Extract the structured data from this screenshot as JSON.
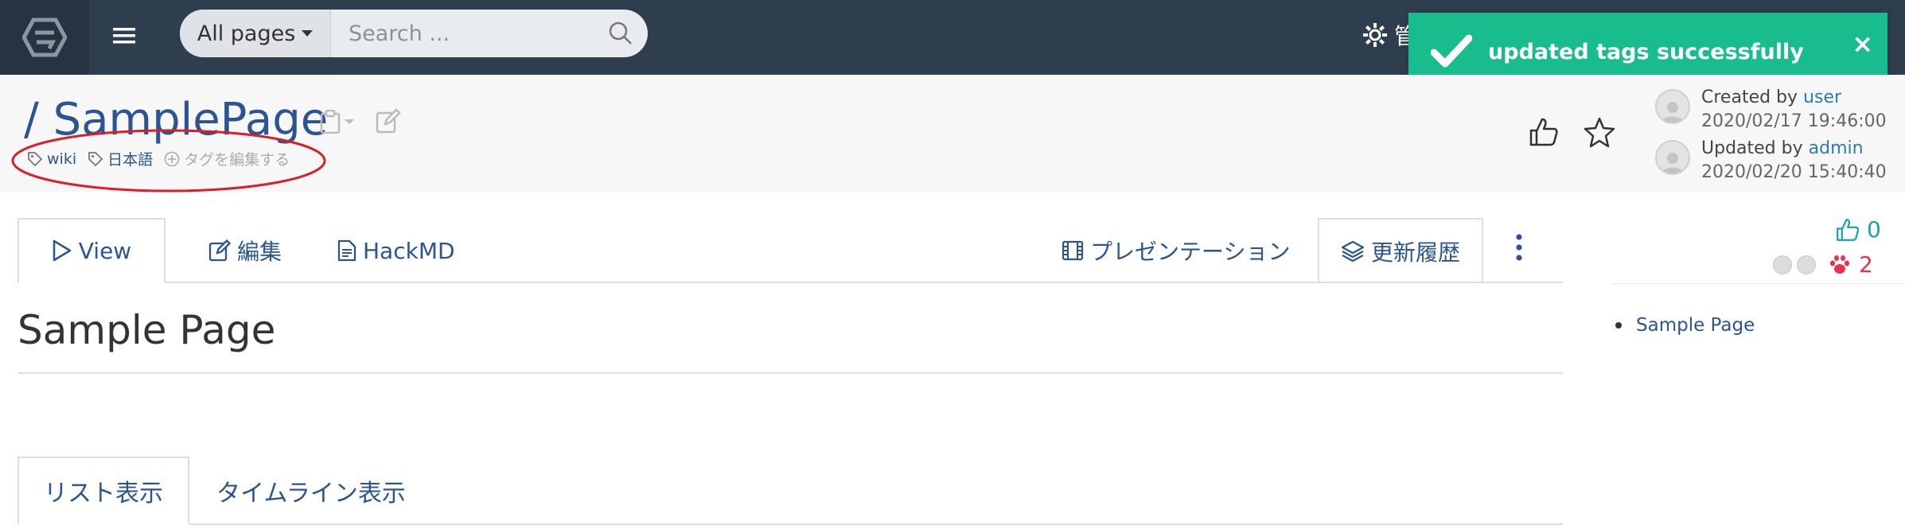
{
  "navbar": {
    "scope_label": "All pages",
    "search_placeholder": "Search ...",
    "admin_label": "管"
  },
  "toast": {
    "message": "updated tags successfully",
    "close_glyph": "×"
  },
  "page": {
    "path": "/ SamplePage",
    "tags": [
      "wiki",
      "日本語"
    ],
    "edit_tags_label": "タグを編集する"
  },
  "authors": {
    "created_prefix": "Created by",
    "created_user": "user",
    "created_date": "2020/02/17 19:46:00",
    "updated_prefix": "Updated by",
    "updated_user": "admin",
    "updated_date": "2020/02/20 15:40:40"
  },
  "tabs": {
    "view": "View",
    "edit": "編集",
    "hackmd": "HackMD",
    "presentation": "プレゼンテーション",
    "history": "更新履歴"
  },
  "content": {
    "heading": "Sample Page"
  },
  "sidebar": {
    "like_count": "0",
    "seen_count": "2",
    "toc": [
      "Sample Page"
    ]
  },
  "bottom_tabs": {
    "list": "リスト表示",
    "timeline": "タイムライン表示"
  },
  "colors": {
    "navbar": "#2f3e4e",
    "toast": "#19bc8c",
    "link": "#2a5592",
    "annotation_red": "#d9202a"
  }
}
